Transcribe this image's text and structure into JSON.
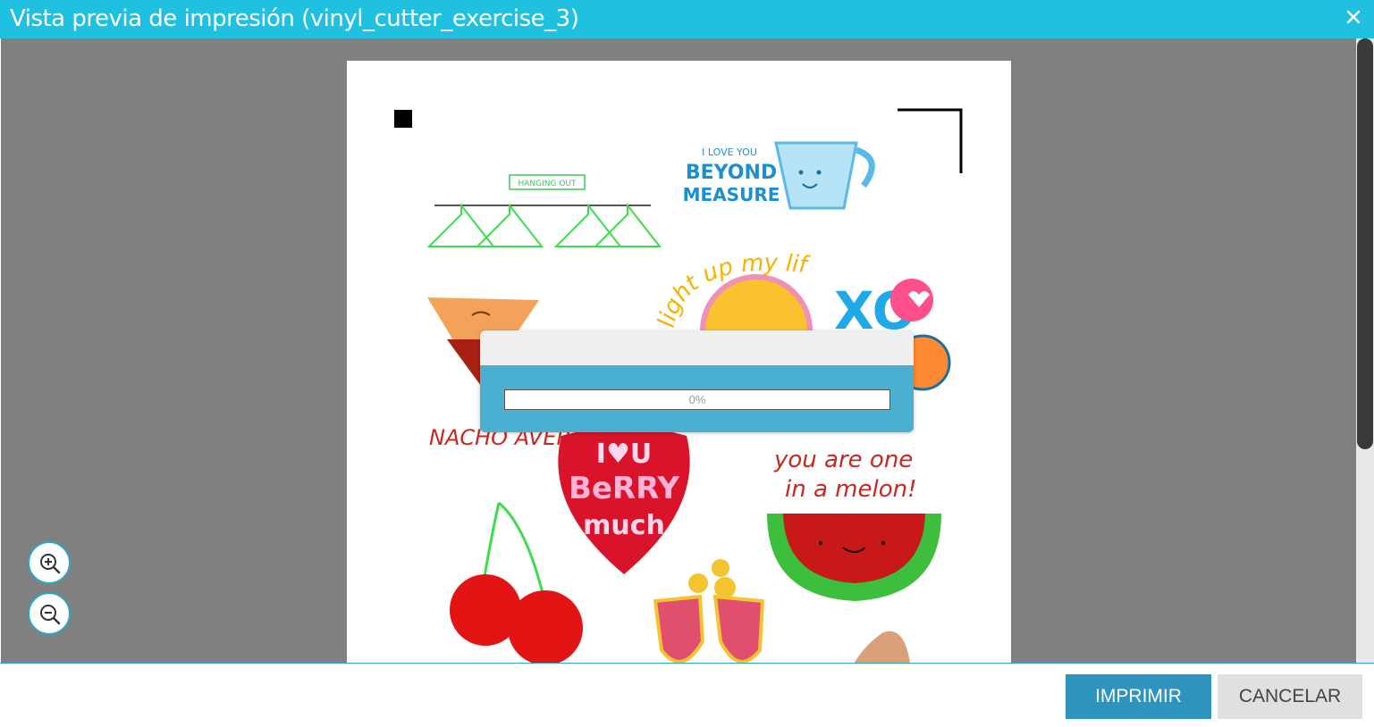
{
  "window": {
    "title": "Vista previa de impresión (vinyl_cutter_exercise_3)",
    "accent_color": "#20c0e0",
    "close_icon": "close-icon"
  },
  "preview": {
    "background_color": "#808080",
    "page_color": "#ffffff",
    "artwork_texts": {
      "hanging_out": "HANGING OUT",
      "love_you_line1": "I LOVE YOU",
      "love_you_line2": "BEYOND",
      "love_you_line3": "MEASURE",
      "light_up": "light up my life",
      "xo": "XO",
      "berry_line1": "I♥U",
      "berry_line2": "BeRRY",
      "berry_line3": "much",
      "melon_line1": "you are one",
      "melon_line2": "in a melon!",
      "nacho": "NACHO AVERAGE"
    }
  },
  "zoom": {
    "zoom_in_icon": "zoom-in-icon",
    "zoom_out_icon": "zoom-out-icon"
  },
  "progress": {
    "value": 0,
    "label": "0%"
  },
  "footer": {
    "print_label": "IMPRIMIR",
    "cancel_label": "CANCELAR"
  }
}
